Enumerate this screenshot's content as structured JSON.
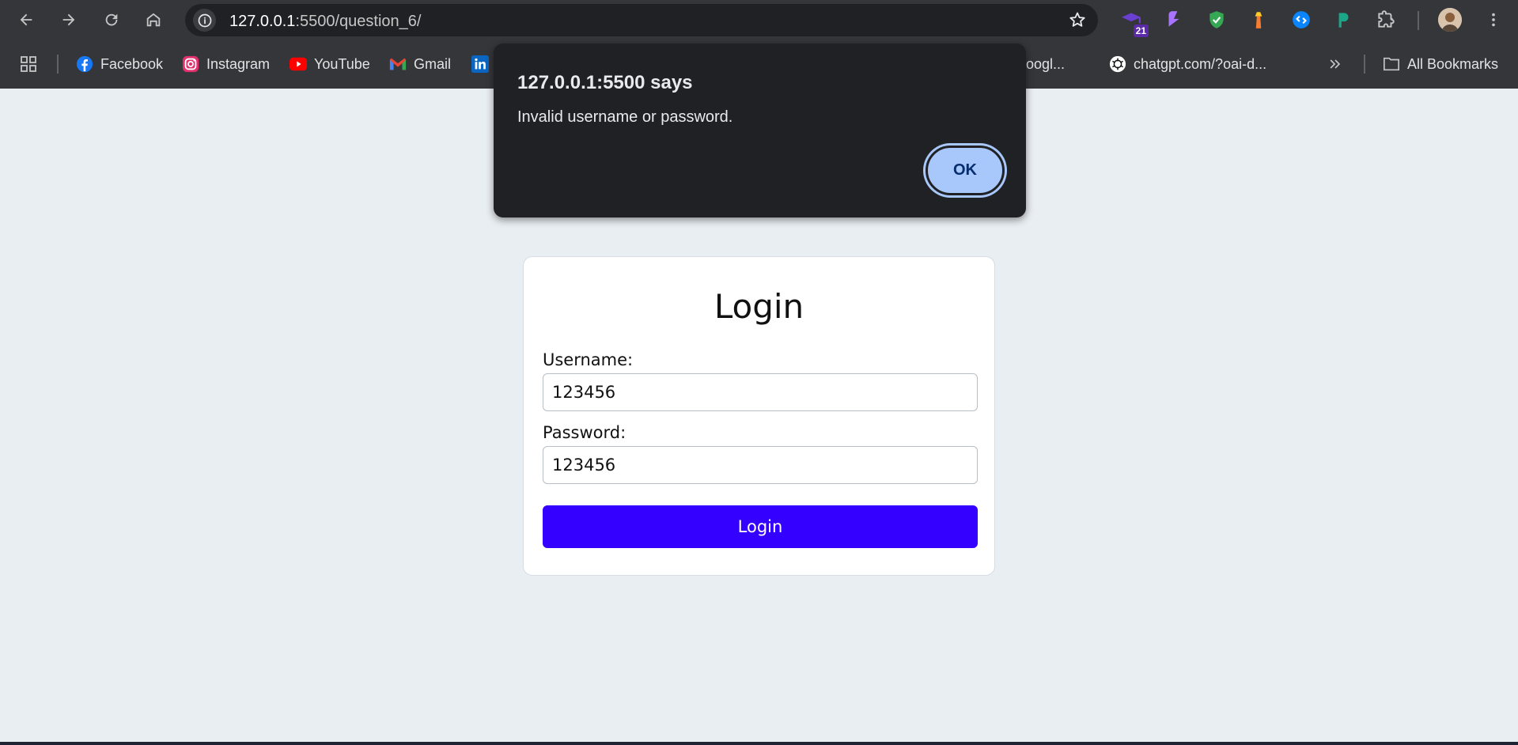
{
  "browser": {
    "url_host": "127.0.0.1",
    "url_path": ":5500/question_6/",
    "extension_badge": "21",
    "bookmarks": [
      {
        "label": "Facebook",
        "icon": "facebook-icon"
      },
      {
        "label": "Instagram",
        "icon": "instagram-icon"
      },
      {
        "label": "YouTube",
        "icon": "youtube-icon"
      },
      {
        "label": "Gmail",
        "icon": "gmail-icon"
      },
      {
        "label": "- Googl...",
        "icon": ""
      },
      {
        "label": "chatgpt.com/?oai-d...",
        "icon": "chatgpt-icon"
      }
    ],
    "all_bookmarks_label": "All Bookmarks"
  },
  "alert": {
    "title": "127.0.0.1:5500 says",
    "message": "Invalid username or password.",
    "ok_label": "OK"
  },
  "login_form": {
    "title": "Login",
    "username_label": "Username:",
    "username_value": "123456",
    "password_label": "Password:",
    "password_value": "123456",
    "submit_label": "Login",
    "accent_color": "#3400ff"
  }
}
